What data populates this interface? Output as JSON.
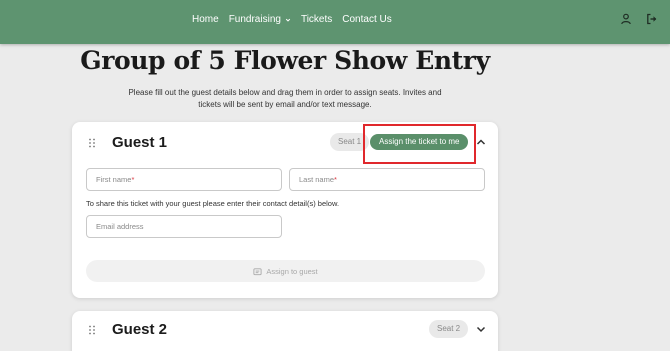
{
  "nav": {
    "home": "Home",
    "fundraising": "Fundraising",
    "tickets": "Tickets",
    "contact": "Contact Us"
  },
  "icons": {
    "user": "user-icon",
    "logout": "logout-icon",
    "chevron": "chevron-down-icon",
    "drag": "drag-handle-icon",
    "chevron_up": "chevron-up-icon",
    "ticket": "ticket-icon"
  },
  "colors": {
    "header": "#5e9470",
    "accent_button": "#5a8f6a",
    "highlight": "#e0282c",
    "required": "#d9363e"
  },
  "page": {
    "title": "Group of 5 Flower Show Entry",
    "intro": "Please fill out the guest details below and drag them in order to assign seats. Invites and tickets will be sent by email and/or text message."
  },
  "guests": [
    {
      "title": "Guest 1",
      "seat": "Seat 1",
      "assign_me": "Assign the ticket to me",
      "first_name_placeholder": "First name",
      "last_name_placeholder": "Last name",
      "required_mark": "*",
      "share_note": "To share this ticket with your guest please enter their contact detail(s) below.",
      "email_placeholder": "Email address",
      "assign_guest": "Assign to guest"
    },
    {
      "title": "Guest 2",
      "seat": "Seat 2"
    }
  ]
}
